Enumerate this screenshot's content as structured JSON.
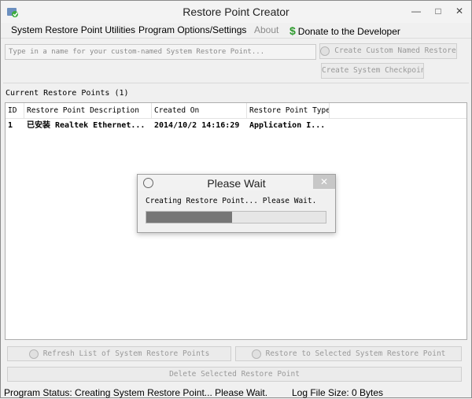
{
  "window": {
    "title": "Restore Point Creator",
    "controls": [
      "—",
      "□",
      "✕"
    ]
  },
  "menu": {
    "items": [
      {
        "label": "System Restore Point Utilities"
      },
      {
        "label": "Program Options/Settings"
      },
      {
        "label": "About"
      },
      {
        "label": "Donate to the Developer"
      }
    ]
  },
  "create": {
    "input_placeholder": "Type in a name for your custom-named System Restore Point...",
    "custom_button": "Create Custom Named Restore",
    "checkpoint_button": "Create System Checkpoint"
  },
  "list": {
    "section_label": "Current Restore Points (1)",
    "columns": [
      "ID",
      "Restore Point Description",
      "Created On",
      "Restore Point Type"
    ],
    "rows": [
      {
        "id": "1",
        "description": "已安装 Realtek Ethernet...",
        "created": "2014/10/2 14:16:29",
        "type": "Application I..."
      }
    ]
  },
  "dialog": {
    "title": "Please Wait",
    "close": "✕",
    "message": "Creating Restore Point... Please Wait.",
    "progress": 0.48
  },
  "actions": {
    "refresh": "Refresh List of System Restore Points",
    "restore": "Restore to Selected System Restore Point",
    "delete": "Delete Selected Restore Point"
  },
  "status": {
    "program_status": "Program Status:  Creating System Restore Point... Please Wait.",
    "log_size": "Log File Size:  0 Bytes"
  },
  "colors": {
    "progress_fill": "#767676",
    "dialog_close_bg": "#c7c7c7",
    "donate_icon": "#2e9b2e"
  }
}
